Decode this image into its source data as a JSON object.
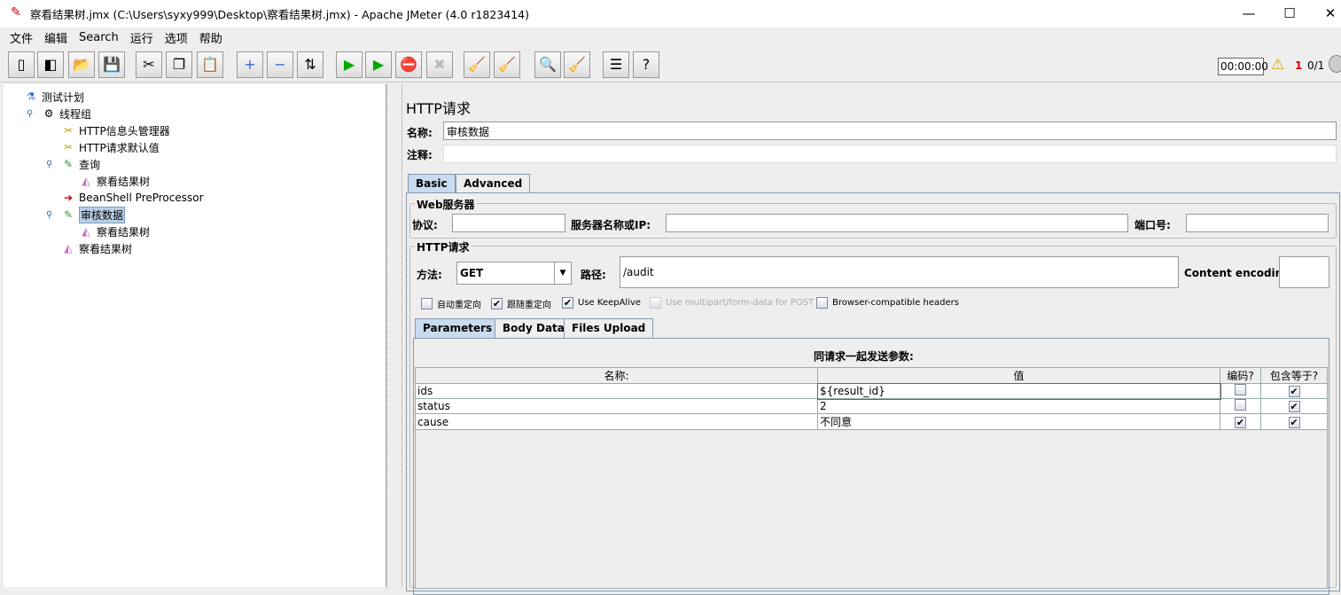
{
  "window": {
    "title": "察看结果树.jmx (C:\\Users\\syxy999\\Desktop\\察看结果树.jmx) - Apache JMeter (4.0 r1823414)",
    "minimize": "—",
    "maximize": "☐",
    "close": "✕"
  },
  "menu": [
    "文件",
    "编辑",
    "Search",
    "运行",
    "选项",
    "帮助"
  ],
  "toolbar": {
    "icons": [
      "new-icon",
      "templates-icon",
      "open-icon",
      "save-icon",
      "cut-icon",
      "copy-icon",
      "paste-icon",
      "expand-icon",
      "collapse-icon",
      "toggle-icon",
      "start-icon",
      "start-no-pause-icon",
      "stop-icon",
      "shutdown-icon",
      "clear-icon",
      "clear-all-icon",
      "search-icon",
      "reset-search-icon",
      "function-helper-icon",
      "help-icon"
    ],
    "timer": "00:00:00",
    "warnings": "1",
    "threads": "0/1",
    "warning_color": "#e00000"
  },
  "tree": [
    {
      "label": "测试计划",
      "icon": "test-plan-icon"
    },
    {
      "label": "线程组",
      "icon": "thread-group-icon"
    },
    {
      "label": "HTTP信息头管理器",
      "icon": "config-icon"
    },
    {
      "label": "HTTP请求默认值",
      "icon": "config-icon"
    },
    {
      "label": "查询",
      "icon": "sampler-icon"
    },
    {
      "label": "察看结果树",
      "icon": "listener-icon"
    },
    {
      "label": "BeanShell PreProcessor",
      "icon": "preprocessor-icon"
    },
    {
      "label": "审核数据",
      "icon": "sampler-icon",
      "selected": true
    },
    {
      "label": "察看结果树",
      "icon": "listener-icon"
    },
    {
      "label": "察看结果树",
      "icon": "listener-icon"
    }
  ],
  "panel": {
    "title": "HTTP请求",
    "name_label": "名称:",
    "name_value": "审核数据",
    "comment_label": "注释:",
    "comment_value": "",
    "tabs": [
      "Basic",
      "Advanced"
    ],
    "web_server": {
      "legend": "Web服务器",
      "protocol_label": "协议:",
      "protocol": "",
      "server_label": "服务器名称或IP:",
      "server": "",
      "port_label": "端口号:",
      "port": ""
    },
    "http": {
      "legend": "HTTP请求",
      "method_label": "方法:",
      "method": "GET",
      "path_label": "路径:",
      "path": "/audit",
      "encoding_label": "Content encoding:",
      "encoding": ""
    },
    "checkboxes": [
      {
        "label": "自动重定向",
        "checked": false
      },
      {
        "label": "跟随重定向",
        "checked": true
      },
      {
        "label": "Use KeepAlive",
        "checked": true
      },
      {
        "label": "Use multipart/form-data for POST",
        "checked": false,
        "disabled": true
      },
      {
        "label": "Browser-compatible headers",
        "checked": false
      }
    ],
    "subtabs": [
      "Parameters",
      "Body Data",
      "Files Upload"
    ],
    "params_title": "同请求一起发送参数:",
    "columns": [
      "名称:",
      "值",
      "编码?",
      "包含等于?"
    ],
    "rows": [
      {
        "name": "ids",
        "value": "${result_id}",
        "encode": false,
        "equals": true
      },
      {
        "name": "status",
        "value": "2",
        "encode": false,
        "equals": true
      },
      {
        "name": "cause",
        "value": "不同意",
        "encode": true,
        "equals": true
      }
    ]
  }
}
